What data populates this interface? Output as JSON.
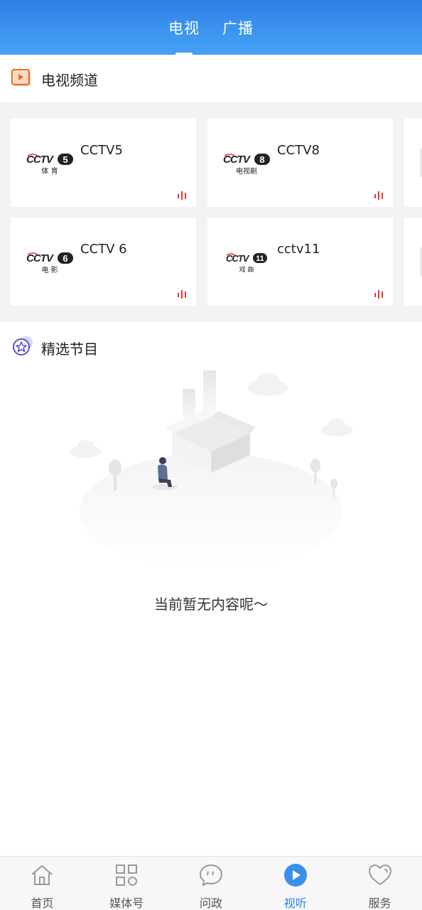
{
  "header": {
    "tabs": [
      {
        "label": "电视",
        "active": true
      },
      {
        "label": "广播",
        "active": false
      }
    ]
  },
  "sections": {
    "channels_title": "电视频道",
    "featured_title": "精选节目"
  },
  "channels": [
    {
      "name": "CCTV5",
      "logo_number": "5",
      "logo_sub": "体 育"
    },
    {
      "name": "CCTV8",
      "logo_number": "8",
      "logo_sub": "电视剧"
    },
    {
      "name": "CCTV 6",
      "logo_number": "6",
      "logo_sub": "电 影"
    },
    {
      "name": "cctv11",
      "logo_number": "11",
      "logo_sub": "戏 曲"
    }
  ],
  "empty_state": {
    "text": "当前暂无内容呢〜"
  },
  "bottom_nav": [
    {
      "label": "首页",
      "icon": "home-icon",
      "active": false
    },
    {
      "label": "媒体号",
      "icon": "grid-icon",
      "active": false
    },
    {
      "label": "问政",
      "icon": "chat-icon",
      "active": false
    },
    {
      "label": "视听",
      "icon": "play-icon",
      "active": true
    },
    {
      "label": "服务",
      "icon": "heart-icon",
      "active": false
    }
  ],
  "colors": {
    "header_blue": "#3d95f0",
    "accent_orange": "#f06a1d",
    "live_red": "#e53935",
    "active_nav": "#2a86e6",
    "featured_purple": "#5a4fcf"
  }
}
